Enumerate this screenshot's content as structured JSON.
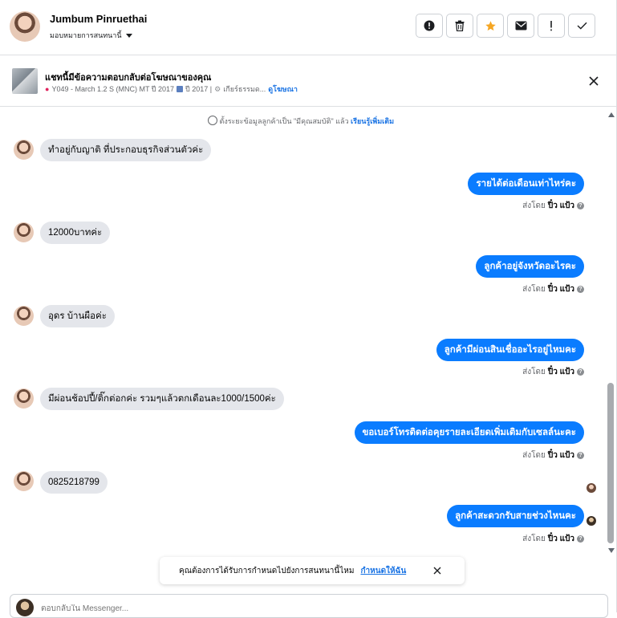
{
  "header": {
    "user_name": "Jumbum Pinruethai",
    "assign_label": "มอบหมายการสนทนานี้",
    "actions": [
      {
        "icon": "alert-circle-icon"
      },
      {
        "icon": "trash-icon"
      },
      {
        "icon": "star-icon"
      },
      {
        "icon": "envelope-icon"
      },
      {
        "icon": "exclamation-icon"
      },
      {
        "icon": "check-icon"
      }
    ]
  },
  "ad": {
    "title": "แชทนี้มีข้อความตอบกลับต่อโฆษณาของคุณ",
    "detail": "Y049 - March 1.2 S (MNC) MT ปี 2017",
    "year": "ปี 2017 |",
    "gear": "เกียร์ธรรมด...",
    "view_ad": "ดูโฆษณา"
  },
  "thread": {
    "notice_text": "ตั้งระยะข้อมูลลูกค้าเป็น \"มีคุณสมบัติ\" แล้ว",
    "notice_link": "เรียนรู้เพิ่มเติม",
    "sent_by_prefix": "ส่งโดย",
    "sent_by_name": "ปิ๋ว แป้ว",
    "messages": [
      {
        "dir": "in",
        "text": "ทำอยู่กับญาติ ที่ประกอบธุรกิจส่วนตัวค่ะ"
      },
      {
        "dir": "out",
        "text": "รายได้ต่อเดือนเท่าไหร่คะ"
      },
      {
        "dir": "in",
        "text": "12000บาทค่ะ"
      },
      {
        "dir": "out",
        "text": "ลูกค้าอยู่จังหวัดอะไรคะ"
      },
      {
        "dir": "in",
        "text": "อุดร บ้านผือค่ะ"
      },
      {
        "dir": "out",
        "text": "ลูกค้ามีผ่อนสินเชื่ออะไรอยู่ไหมคะ"
      },
      {
        "dir": "in",
        "text": "มีผ่อนช้อปปี้/ติ๊กต่อกค่ะ รวมๆแล้วตกเดือนละ1000/1500ค่ะ"
      },
      {
        "dir": "out",
        "text": "ขอเบอร์โทรติดต่อคุยรายละเอียดเพิ่มเติมกับเซลล์นะคะ"
      },
      {
        "dir": "in",
        "text": "0825218799"
      },
      {
        "dir": "out",
        "text": "ลูกค้าสะดวกรับสายช่วงไหนคะ"
      }
    ]
  },
  "toast": {
    "text": "คุณต้องการได้รับการกำหนดไปยังการสนทนานี้ไหม",
    "link": "กำหนดให้ฉัน"
  },
  "composer": {
    "placeholder": "ตอบกลับใน Messenger..."
  },
  "colors": {
    "accent": "#0a7cff",
    "star": "#f5a623",
    "incoming_bubble": "#e4e6eb"
  }
}
